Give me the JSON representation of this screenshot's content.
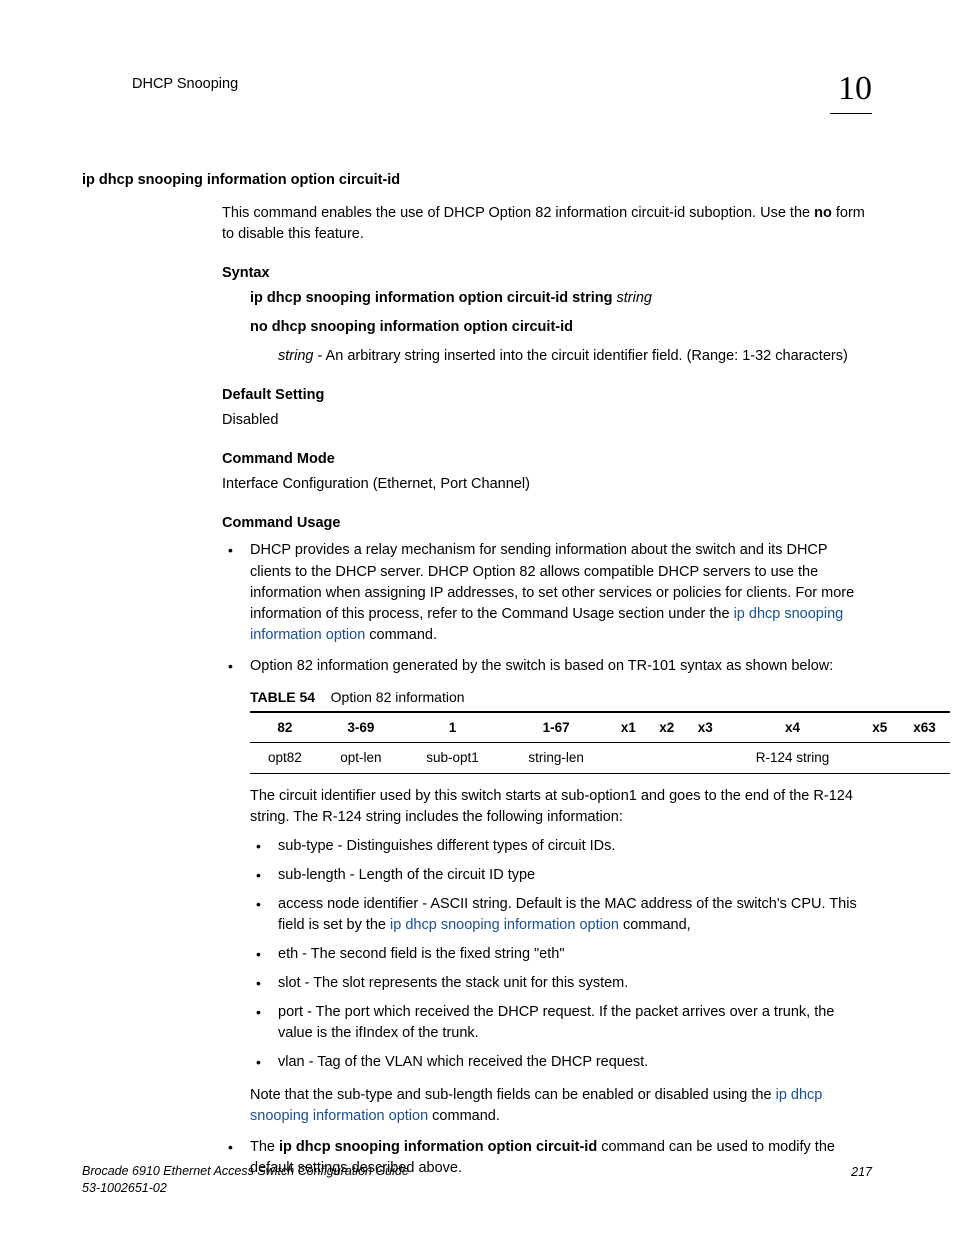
{
  "header": {
    "title": "DHCP Snooping",
    "chapter": "10"
  },
  "section": {
    "title": "ip dhcp snooping information option circuit-id",
    "intro_a": "This command enables the use of DHCP Option 82 information circuit-id suboption. Use the ",
    "intro_no": "no",
    "intro_b": " form to disable this feature.",
    "syntax_heading": "Syntax",
    "syntax_line1_bold": "ip dhcp snooping information option circuit-id string",
    "syntax_line1_italic": " string",
    "syntax_line2_bold": "no dhcp snooping information option circuit-id",
    "syntax_param_name": "string",
    "syntax_param_desc": " - An arbitrary string inserted into the circuit identifier field. (Range: 1-32 characters)",
    "default_heading": "Default Setting",
    "default_value": "Disabled",
    "mode_heading": "Command Mode",
    "mode_value": "Interface Configuration (Ethernet, Port Channel)",
    "usage_heading": "Command Usage"
  },
  "usage_bullets": {
    "b1a": "DHCP provides a relay mechanism for sending information about the switch and its DHCP clients to the DHCP server. DHCP Option 82 allows compatible DHCP servers to use the information when assigning IP addresses, to set other services or policies for clients. For more information of this process, refer to the Command Usage section under the ",
    "b1_link": "ip dhcp snooping information option",
    "b1b": " command.",
    "b2": "Option 82 information generated by the switch is based on TR-101 syntax as shown below:"
  },
  "table": {
    "label": "TABLE 54",
    "caption": "Option 82 information",
    "headers": [
      "82",
      "3-69",
      "1",
      "1-67",
      "x1",
      "x2",
      "x3",
      "x4",
      "x5",
      "x63"
    ],
    "row": [
      "opt82",
      "opt-len",
      "sub-opt1",
      "string-len",
      "",
      "",
      "",
      "R-124 string",
      "",
      ""
    ]
  },
  "after_table": {
    "p1": "The circuit identifier used by this switch starts at sub-option1 and goes to the end of the R-124 string. The R-124 string includes the following information:",
    "sub": [
      {
        "text": "sub-type - Distinguishes different types of circuit IDs."
      },
      {
        "text": "sub-length - Length of the circuit ID type"
      },
      {
        "pre": "access node identifier - ASCII string. Default is the MAC address of the switch's CPU. This field is set by the ",
        "link": "ip dhcp snooping information option",
        "post": " command,"
      },
      {
        "text": "eth - The second field is the fixed string \"eth\""
      },
      {
        "text": "slot - The slot represents the stack unit for this system."
      },
      {
        "text": "port - The port which received the DHCP request. If the packet arrives over a trunk, the value is the ifIndex of the trunk."
      },
      {
        "text": "vlan - Tag of the VLAN which received the DHCP request."
      }
    ],
    "note_a": "Note that the sub-type and sub-length fields can be enabled or disabled using the ",
    "note_link": "ip dhcp snooping information option",
    "note_b": " command.",
    "b3a": "The ",
    "b3_bold": "ip dhcp snooping information option circuit-id",
    "b3b": " command can be used to modify the default settings described above."
  },
  "footer": {
    "line1": "Brocade 6910 Ethernet Access Switch Configuration Guide",
    "line2": "53-1002651-02",
    "page": "217"
  }
}
